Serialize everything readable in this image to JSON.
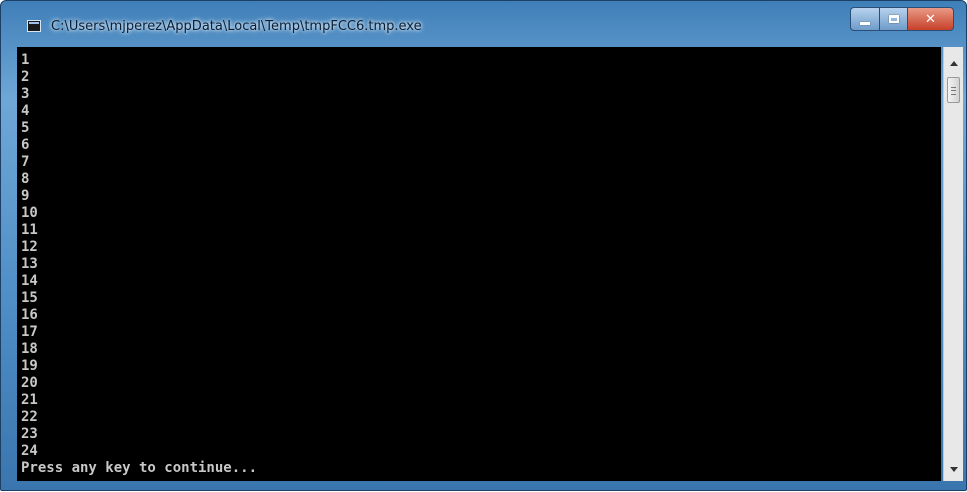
{
  "window": {
    "title": "C:\\Users\\mjperez\\AppData\\Local\\Temp\\tmpFCC6.tmp.exe"
  },
  "console": {
    "lines": [
      "1",
      "2",
      "3",
      "4",
      "5",
      "6",
      "7",
      "8",
      "9",
      "10",
      "11",
      "12",
      "13",
      "14",
      "15",
      "16",
      "17",
      "18",
      "19",
      "20",
      "21",
      "22",
      "23",
      "24",
      "Press any key to continue..."
    ],
    "text_color": "#c8c8c8",
    "background_color": "#000000"
  },
  "caption_buttons": {
    "minimize_icon": "minimize-icon",
    "maximize_icon": "maximize-icon",
    "close_icon": "close-icon",
    "close_color": "#c7402a"
  },
  "scrollbar": {
    "up_icon": "scroll-up-arrow-icon",
    "down_icon": "scroll-down-arrow-icon",
    "position_fraction": 0.0
  }
}
